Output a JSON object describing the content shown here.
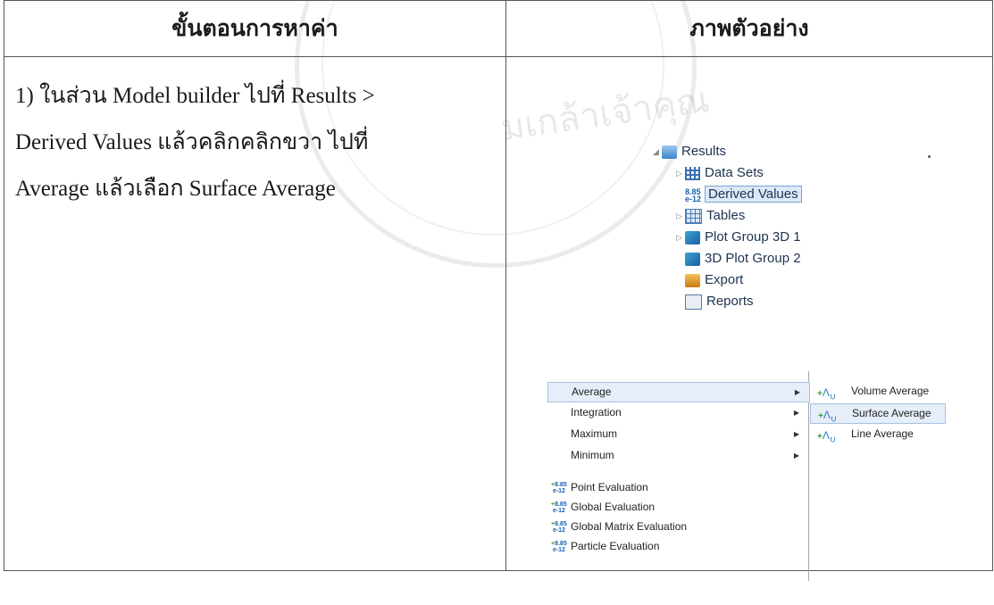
{
  "table": {
    "header_left": "ขั้นตอนการหาค่า",
    "header_right": "ภาพตัวอย่าง"
  },
  "step": {
    "line1": "1) ในส่วน Model builder ไปที่ Results >",
    "line2": "Derived Values แล้วคลิกคลิกขวา ไปที่",
    "line3": "Average แล้วเลือก Surface Average"
  },
  "tree": {
    "items": [
      {
        "label": "Results",
        "icon": "results-folder-icon"
      },
      {
        "label": "Data Sets",
        "icon": "data-sets-grid-icon"
      },
      {
        "label": "Derived Values",
        "icon": "derived-values-icon",
        "selected": true
      },
      {
        "label": "Tables",
        "icon": "table-icon"
      },
      {
        "label": "Plot Group 3D 1",
        "icon": "plot-group-icon"
      },
      {
        "label": "3D Plot Group 2",
        "icon": "plot-group-icon"
      },
      {
        "label": "Export",
        "icon": "export-icon"
      },
      {
        "label": "Reports",
        "icon": "reports-icon"
      }
    ]
  },
  "context_menu": {
    "items": [
      {
        "label": "Average",
        "submenu": true,
        "highlighted": true
      },
      {
        "label": "Integration",
        "submenu": true
      },
      {
        "label": "Maximum",
        "submenu": true
      },
      {
        "label": "Minimum",
        "submenu": true
      },
      {
        "label": "Point Evaluation"
      },
      {
        "label": "Global Evaluation"
      },
      {
        "label": "Global Matrix Evaluation"
      },
      {
        "label": "Particle Evaluation"
      }
    ],
    "eval_icon_text": "8.85 e-12",
    "submenu": [
      {
        "label": "Volume Average"
      },
      {
        "label": "Surface Average",
        "highlighted": true
      },
      {
        "label": "Line Average"
      }
    ]
  },
  "watermark": {
    "text": "มเกล้าเจ้าคุณ"
  },
  "colors": {
    "tree_text": "#1e3350",
    "highlight": "#e6eef9",
    "highlight_border": "#a9c1e3"
  }
}
